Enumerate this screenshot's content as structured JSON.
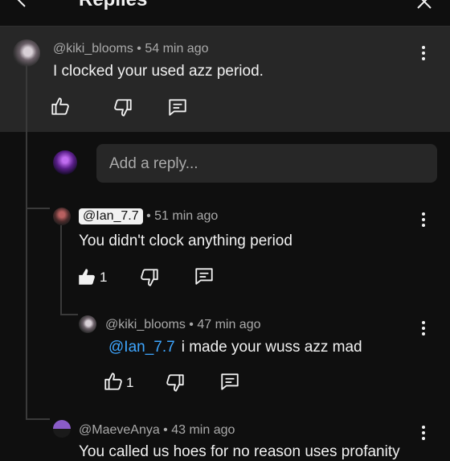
{
  "header": {
    "title": "Replies"
  },
  "parent_comment": {
    "author": "@kiki_blooms",
    "time": "54 min ago",
    "text": "I clocked your used azz period."
  },
  "reply_input": {
    "placeholder": "Add a reply..."
  },
  "replies": [
    {
      "author": "@Ian_7.7",
      "time": "51 min ago",
      "text": "You didn't clock anything period",
      "likes": "1"
    },
    {
      "author": "@kiki_blooms",
      "time": "47 min ago",
      "mention": "@Ian_7.7",
      "text": "i made your wuss azz mad",
      "likes": "1"
    },
    {
      "author": "@MaeveAnya",
      "time": "43 min ago",
      "text": "You called us hoes for no reason uses profanity"
    }
  ],
  "separator": " • ",
  "colors": {
    "background": "#0f0f0f",
    "highlight": "#272727",
    "mention": "#3ea6ff"
  }
}
